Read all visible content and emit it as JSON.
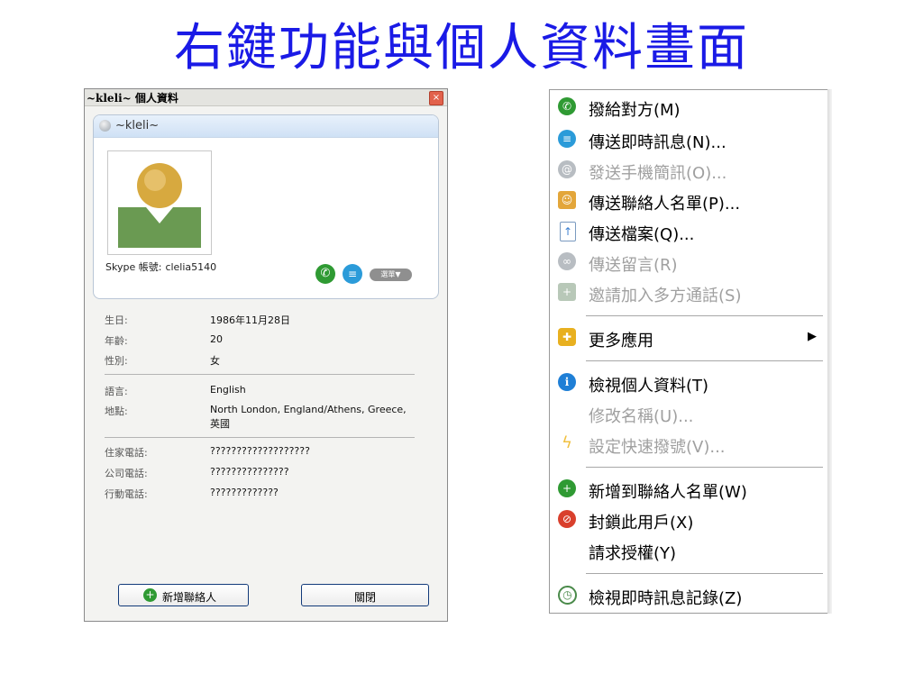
{
  "slide": {
    "title": "右鍵功能與個人資料畫面"
  },
  "dialog": {
    "title": "~kleli~ 個人資料",
    "close_glyph": "×",
    "display_name": "~kleli~",
    "account_label": "Skype 帳號:",
    "account_value": "clelia5140",
    "menu_pill": "選單▼",
    "fields": [
      {
        "label": "生日:",
        "value": "1986年11月28日"
      },
      {
        "label": "年齡:",
        "value": "20"
      },
      {
        "label": "性別:",
        "value": "女"
      },
      {
        "label": "語言:",
        "value": "English"
      },
      {
        "label": "地點:",
        "value": "North London, England/Athens, Greece,",
        "value2": "英國"
      },
      {
        "label": "住家電話:",
        "value": "???????????????????"
      },
      {
        "label": "公司電話:",
        "value": "???????????????"
      },
      {
        "label": "行動電話:",
        "value": "?????????????"
      }
    ],
    "add_contact_label": "新增聯絡人",
    "close_label": "關閉"
  },
  "context_menu": {
    "items": [
      {
        "label": "撥給對方(M)",
        "icon": "phone-icon",
        "color": "#2f9a33",
        "disabled": false
      },
      {
        "label": "傳送即時訊息(N)...",
        "icon": "chat-icon",
        "color": "#2b9bd9",
        "disabled": false
      },
      {
        "label": "發送手機簡訊(O)...",
        "icon": "sms-icon",
        "color": "#b8bdc2",
        "disabled": true
      },
      {
        "label": "傳送聯絡人名單(P)...",
        "icon": "contacts-send-icon",
        "color": "#e3a63a",
        "disabled": false
      },
      {
        "label": "傳送檔案(Q)...",
        "icon": "file-upload-icon",
        "color": "#3b7fd1",
        "disabled": false
      },
      {
        "label": "傳送留言(R)",
        "icon": "voicemail-icon",
        "color": "#b8bdc2",
        "disabled": true
      },
      {
        "label": "邀請加入多方通話(S)",
        "icon": "conference-icon",
        "color": "#b8c8b8",
        "disabled": true
      },
      {
        "label": "更多應用",
        "icon": "puzzle-icon",
        "color": "#e8b020",
        "disabled": false,
        "submenu": true
      },
      {
        "label": "檢視個人資料(T)",
        "icon": "info-icon",
        "color": "#1f7fd6",
        "disabled": false
      },
      {
        "label": "修改名稱(U)...",
        "icon": "",
        "color": "",
        "disabled": true
      },
      {
        "label": "設定快速撥號(V)...",
        "icon": "lightning-icon",
        "color": "#f0c040",
        "disabled": true
      },
      {
        "label": "新增到聯絡人名單(W)",
        "icon": "add-contact-icon",
        "color": "#2f9a33",
        "disabled": false
      },
      {
        "label": "封鎖此用戶(X)",
        "icon": "block-icon",
        "color": "#d9402d",
        "disabled": false
      },
      {
        "label": "請求授權(Y)",
        "icon": "",
        "color": "",
        "disabled": false
      },
      {
        "label": "檢視即時訊息記錄(Z)",
        "icon": "history-clock-icon",
        "color": "#4a8a4a",
        "disabled": false
      }
    ],
    "submenu_arrow": "▶"
  }
}
